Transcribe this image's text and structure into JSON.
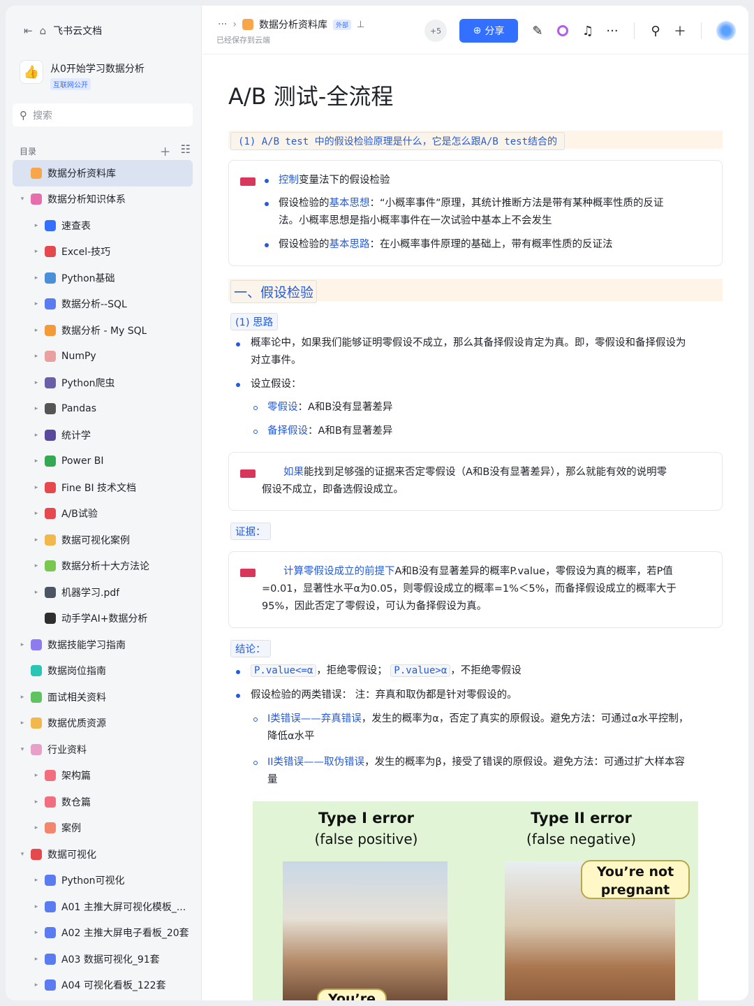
{
  "sidebar": {
    "home_label": "飞书云文档",
    "workspace": {
      "name": "从0开始学习数据分析",
      "tag": "互联网公开"
    },
    "search_placeholder": "搜索",
    "toc_label": "目录",
    "items": [
      {
        "label": "数据分析资料库",
        "depth": 0,
        "caret": "",
        "icon": "library-icon",
        "color": "#f7a64a",
        "selected": true
      },
      {
        "label": "数据分析知识体系",
        "depth": 0,
        "caret": "▾",
        "icon": "knowledge-icon",
        "color": "#e76dac"
      },
      {
        "label": "速查表",
        "depth": 1,
        "caret": "▸",
        "icon": "magnifier-icon",
        "color": "#3370ff"
      },
      {
        "label": "Excel-技巧",
        "depth": 1,
        "caret": "▸",
        "icon": "hundred-icon",
        "color": "#e5484d"
      },
      {
        "label": "Python基础",
        "depth": 1,
        "caret": "▸",
        "icon": "monitor-icon",
        "color": "#4a90d9"
      },
      {
        "label": "数据分析--SQL",
        "depth": 1,
        "caret": "▸",
        "icon": "bar-chart-icon",
        "color": "#5b7cf0"
      },
      {
        "label": "数据分析 - My SQL",
        "depth": 1,
        "caret": "▸",
        "icon": "rainbow-icon",
        "color": "#f29b38"
      },
      {
        "label": "NumPy",
        "depth": 1,
        "caret": "▸",
        "icon": "memo-icon",
        "color": "#e8a0a0"
      },
      {
        "label": "Python爬虫",
        "depth": 1,
        "caret": "▸",
        "icon": "spider-icon",
        "color": "#6b5fa8"
      },
      {
        "label": "Pandas",
        "depth": 1,
        "caret": "▸",
        "icon": "panda-icon",
        "color": "#555"
      },
      {
        "label": "统计学",
        "depth": 1,
        "caret": "▸",
        "icon": "floppy-icon",
        "color": "#5a4a9c"
      },
      {
        "label": "Power BI",
        "depth": 1,
        "caret": "▸",
        "icon": "recycle-icon",
        "color": "#34a853"
      },
      {
        "label": "Fine BI 技术文档",
        "depth": 1,
        "caret": "▸",
        "icon": "pushpin-icon",
        "color": "#e5484d"
      },
      {
        "label": "A/B试验",
        "depth": 1,
        "caret": "▸",
        "icon": "ab-icon",
        "color": "#e5484d"
      },
      {
        "label": "数据可视化案例",
        "depth": 1,
        "caret": "▸",
        "icon": "medal-icon",
        "color": "#f2b84b"
      },
      {
        "label": "数据分析十大方法论",
        "depth": 1,
        "caret": "▸",
        "icon": "puzzle-icon",
        "color": "#7ac74f"
      },
      {
        "label": "机器学习.pdf",
        "depth": 1,
        "caret": "▸",
        "icon": "robot-icon",
        "color": "#4b5563"
      },
      {
        "label": "动手学AI+数据分析",
        "depth": 1,
        "caret": "",
        "icon": "traffic-light-icon",
        "color": "#2f2f2f"
      },
      {
        "label": "数据技能学习指南",
        "depth": 0,
        "caret": "▸",
        "icon": "guide-icon",
        "color": "#8b7cf0"
      },
      {
        "label": "数据岗位指南",
        "depth": 0,
        "caret": "",
        "icon": "compass-icon",
        "color": "#29c5b5"
      },
      {
        "label": "面试相关资料",
        "depth": 0,
        "caret": "▸",
        "icon": "target-icon",
        "color": "#5fc45f"
      },
      {
        "label": "数据优质资源",
        "depth": 0,
        "caret": "▸",
        "icon": "thumbs-up-icon",
        "color": "#f2b84b"
      },
      {
        "label": "行业资料",
        "depth": 0,
        "caret": "▾",
        "icon": "flower-icon",
        "color": "#e8a0c8"
      },
      {
        "label": "架构篇",
        "depth": 1,
        "caret": "▸",
        "icon": "architecture-icon",
        "color": "#f26d7d"
      },
      {
        "label": "数仓篇",
        "depth": 1,
        "caret": "▸",
        "icon": "warehouse-icon",
        "color": "#f26d7d"
      },
      {
        "label": "案例",
        "depth": 1,
        "caret": "▸",
        "icon": "case-icon",
        "color": "#f2876d"
      },
      {
        "label": "数据可视化",
        "depth": 0,
        "caret": "▾",
        "icon": "rocket-icon",
        "color": "#e5484d"
      },
      {
        "label": "Python可视化",
        "depth": 1,
        "caret": "▸",
        "icon": "bar-chart-icon",
        "color": "#5b7cf0"
      },
      {
        "label": "A01 主推大屏可视化模板_...",
        "depth": 1,
        "caret": "▸",
        "icon": "bar-chart-icon",
        "color": "#5b7cf0"
      },
      {
        "label": "A02 主推大屏电子看板_20套",
        "depth": 1,
        "caret": "▸",
        "icon": "bar-chart-icon",
        "color": "#5b7cf0"
      },
      {
        "label": "A03 数据可视化_91套",
        "depth": 1,
        "caret": "▸",
        "icon": "bar-chart-icon",
        "color": "#5b7cf0"
      },
      {
        "label": "A04 可视化看板_122套",
        "depth": 1,
        "caret": "▸",
        "icon": "bar-chart-icon",
        "color": "#5b7cf0"
      }
    ]
  },
  "header": {
    "more": "···",
    "title": "数据分析资料库",
    "ext_tag": "外部",
    "saved": "已经保存到云端",
    "collab_count": "+5",
    "share_label": "分享"
  },
  "doc": {
    "title": "A/B 测试-全流程",
    "q1": "(1) A/B test 中的假设检验原理是什么，它是怎么跟A/B test结合的",
    "callout1": {
      "b1_link": "控制",
      "b1_rest": "变量法下的假设检验",
      "b2_a": "假设检验的",
      "b2_link": "基本思想",
      "b2_b": "：“小概率事件”原理，其统计推断方法是带有某种概率性质的反证",
      "b2_c": "法。小概率思想是指小概率事件在一次试验中基本上不会发生",
      "b3_a": "假设检验的",
      "b3_link": "基本思路",
      "b3_b": "：在小概率事件原理的基础上，带有概率性质的反证法"
    },
    "h_hypo": "一、假设检验",
    "tag_siliu": "(1) 思路",
    "p1a": "概率论中，如果我们能够证明零假设不成立，那么其备择假设肯定为真。即，零假设和备择假设为",
    "p1b": "对立事件。",
    "p2": "设立假设：",
    "p2_1_link": "零假设",
    "p2_1_rest": "：A和B没有显著差异",
    "p2_2_link": "备择假设",
    "p2_2_rest": "：A和B有显著差异",
    "callout2": {
      "link": "如果",
      "a": "能找到足够强的证据来否定零假设（A和B没有显著差异），那么就能有效的说明零",
      "b": "假设不成立，即备选假设成立。"
    },
    "tag_proof": "证据：",
    "callout3": {
      "link": "计算零假设成立的前提下",
      "a": "A和B没有显著差异的概率P.value，零假设为真的概率，若P值",
      "b": "=0.01，显著性水平α为0.05，则零假设成立的概率=1%＜5%，而备择假设成立的概率大于",
      "c": "95%，因此否定了零假设，可认为备择假设为真。"
    },
    "tag_concl": "结论：",
    "c1_code1": "P.value<=α",
    "c1_mid": "，拒绝零假设；",
    "c1_code2": "P.value>α",
    "c1_end": "，不拒绝零假设",
    "c2": "假设检验的两类错误： 注：弃真和取伪都是针对零假设的。",
    "c2_1_link": "I类错误——弃真错误",
    "c2_1_rest": "，发生的概率为α，否定了真实的原假设。避免方法：可通过α水平控制，",
    "c2_1_cont": "降低α水平",
    "c2_2_link": "II类错误——取伪错误",
    "c2_2_rest": "，发生的概率为β，接受了错误的原假设。避免方法：可通过扩大样本容",
    "c2_2_cont": "量",
    "figure": {
      "t1": "Type I error",
      "s1": "(false positive)",
      "t2": "Type II error",
      "s2": "(false negative)",
      "bubble2": "You’re not pregnant",
      "bubble1": "You’re"
    }
  }
}
